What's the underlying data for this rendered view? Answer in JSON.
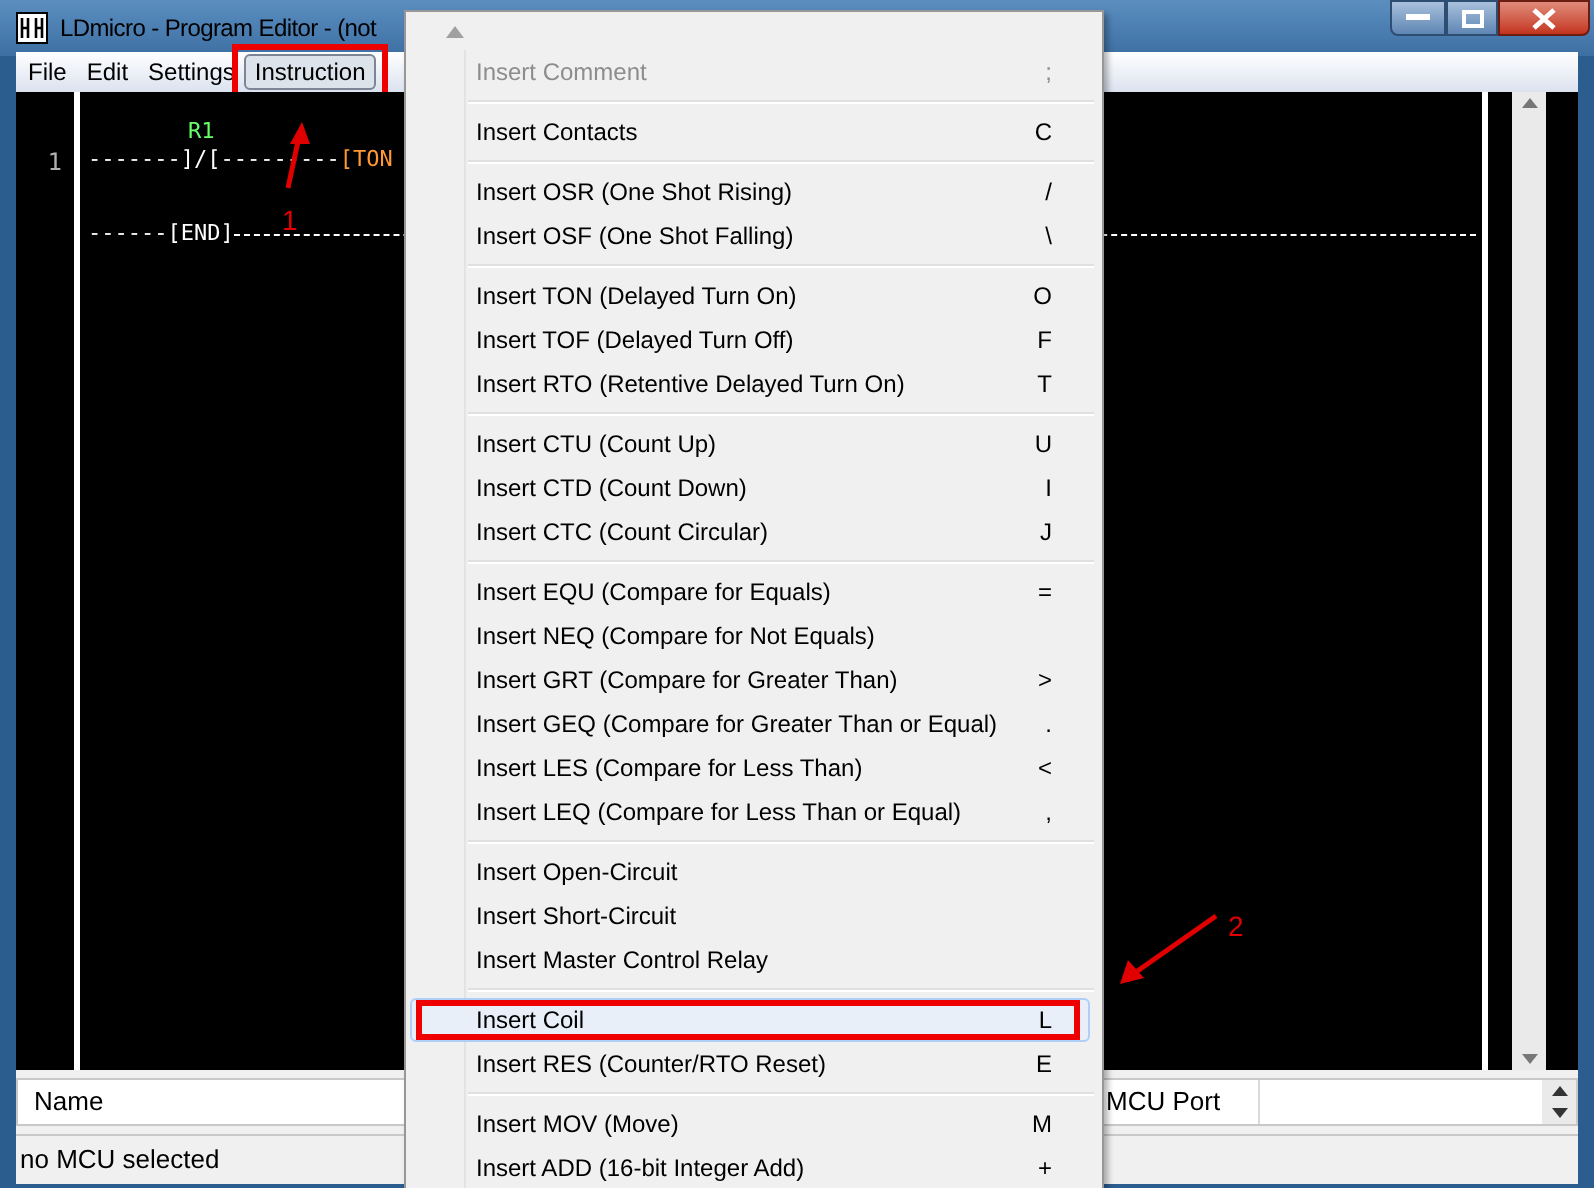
{
  "window": {
    "title": "LDmicro - Program Editor - (not"
  },
  "menubar": [
    {
      "label": "File",
      "selected": false,
      "outlined": false
    },
    {
      "label": "Edit",
      "selected": false,
      "outlined": false
    },
    {
      "label": "Settings",
      "selected": false,
      "outlined": false
    },
    {
      "label": "Instruction",
      "selected": true,
      "outlined": true
    }
  ],
  "editor": {
    "rungs": [
      {
        "number": "1",
        "label": "R1",
        "contacts": "-------]/[---------",
        "element": "[TON"
      },
      {
        "end": "------[END]"
      }
    ]
  },
  "menu": {
    "items": [
      {
        "kind": "item",
        "label": "Insert Comment",
        "shortcut": ";",
        "disabled": true,
        "selected": false,
        "outlined": false
      },
      {
        "kind": "separator"
      },
      {
        "kind": "item",
        "label": "Insert Contacts",
        "shortcut": "C",
        "disabled": false,
        "selected": false,
        "outlined": false
      },
      {
        "kind": "separator"
      },
      {
        "kind": "item",
        "label": "Insert OSR (One Shot Rising)",
        "shortcut": "/",
        "disabled": false,
        "selected": false,
        "outlined": false
      },
      {
        "kind": "item",
        "label": "Insert OSF (One Shot Falling)",
        "shortcut": "\\",
        "disabled": false,
        "selected": false,
        "outlined": false
      },
      {
        "kind": "separator"
      },
      {
        "kind": "item",
        "label": "Insert TON (Delayed Turn On)",
        "shortcut": "O",
        "disabled": false,
        "selected": false,
        "outlined": false
      },
      {
        "kind": "item",
        "label": "Insert TOF (Delayed Turn Off)",
        "shortcut": "F",
        "disabled": false,
        "selected": false,
        "outlined": false
      },
      {
        "kind": "item",
        "label": "Insert RTO (Retentive Delayed Turn On)",
        "shortcut": "T",
        "disabled": false,
        "selected": false,
        "outlined": false
      },
      {
        "kind": "separator"
      },
      {
        "kind": "item",
        "label": "Insert CTU (Count Up)",
        "shortcut": "U",
        "disabled": false,
        "selected": false,
        "outlined": false
      },
      {
        "kind": "item",
        "label": "Insert CTD (Count Down)",
        "shortcut": "I",
        "disabled": false,
        "selected": false,
        "outlined": false
      },
      {
        "kind": "item",
        "label": "Insert CTC (Count Circular)",
        "shortcut": "J",
        "disabled": false,
        "selected": false,
        "outlined": false
      },
      {
        "kind": "separator"
      },
      {
        "kind": "item",
        "label": "Insert EQU (Compare for Equals)",
        "shortcut": "=",
        "disabled": false,
        "selected": false,
        "outlined": false
      },
      {
        "kind": "item",
        "label": "Insert NEQ (Compare for Not Equals)",
        "disabled": false,
        "selected": false,
        "outlined": false
      },
      {
        "kind": "item",
        "label": "Insert GRT (Compare for Greater Than)",
        "shortcut": ">",
        "disabled": false,
        "selected": false,
        "outlined": false
      },
      {
        "kind": "item",
        "label": "Insert GEQ (Compare for Greater Than or Equal)",
        "shortcut": ".",
        "disabled": false,
        "selected": false,
        "outlined": false
      },
      {
        "kind": "item",
        "label": "Insert LES (Compare for Less Than)",
        "shortcut": "<",
        "disabled": false,
        "selected": false,
        "outlined": false
      },
      {
        "kind": "item",
        "label": "Insert LEQ (Compare for Less Than or Equal)",
        "shortcut": ",",
        "disabled": false,
        "selected": false,
        "outlined": false
      },
      {
        "kind": "separator"
      },
      {
        "kind": "item",
        "label": "Insert Open-Circuit",
        "disabled": false,
        "selected": false,
        "outlined": false
      },
      {
        "kind": "item",
        "label": "Insert Short-Circuit",
        "disabled": false,
        "selected": false,
        "outlined": false
      },
      {
        "kind": "item",
        "label": "Insert Master Control Relay",
        "disabled": false,
        "selected": false,
        "outlined": false
      },
      {
        "kind": "separator"
      },
      {
        "kind": "item",
        "label": "Insert Coil",
        "shortcut": "L",
        "disabled": false,
        "selected": true,
        "outlined": true
      },
      {
        "kind": "item",
        "label": "Insert RES (Counter/RTO Reset)",
        "shortcut": "E",
        "disabled": false,
        "selected": false,
        "outlined": false
      },
      {
        "kind": "separator"
      },
      {
        "kind": "item",
        "label": "Insert MOV (Move)",
        "shortcut": "M",
        "disabled": false,
        "selected": false,
        "outlined": false
      },
      {
        "kind": "item",
        "label": "Insert ADD (16-bit Integer Add)",
        "shortcut": "+",
        "disabled": false,
        "selected": false,
        "outlined": false
      }
    ]
  },
  "io_list": {
    "columns": [
      "Name",
      "MCU Port"
    ]
  },
  "status_bar": "no MCU selected",
  "annotations": [
    {
      "label": "1"
    },
    {
      "label": "2"
    }
  ]
}
